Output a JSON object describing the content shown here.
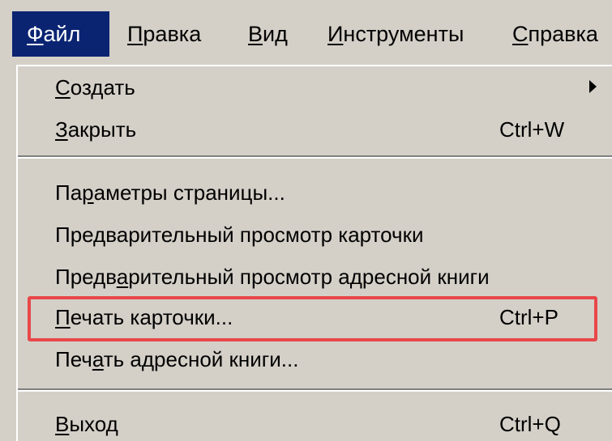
{
  "menubar": {
    "items": [
      {
        "label": "Файл",
        "active": true
      },
      {
        "label": "Правка",
        "active": false
      },
      {
        "label": "Вид",
        "active": false
      },
      {
        "label": "Инструменты",
        "active": false
      },
      {
        "label": "Справка",
        "active": false
      }
    ]
  },
  "file_menu": {
    "items": [
      {
        "label": "Создать",
        "shortcut": "",
        "has_submenu": true
      },
      {
        "label": "Закрыть",
        "shortcut": "Ctrl+W",
        "has_submenu": false
      },
      {
        "label": "Параметры страницы...",
        "shortcut": "",
        "has_submenu": false
      },
      {
        "label": "Предварительный просмотр карточки",
        "shortcut": "",
        "has_submenu": false
      },
      {
        "label": "Предварительный просмотр адресной книги",
        "shortcut": "",
        "has_submenu": false
      },
      {
        "label": "Печать карточки...",
        "shortcut": "Ctrl+P",
        "has_submenu": false,
        "highlighted": true
      },
      {
        "label": "Печать адресной книги...",
        "shortcut": "",
        "has_submenu": false
      },
      {
        "label": "Выход",
        "shortcut": "Ctrl+Q",
        "has_submenu": false
      }
    ]
  },
  "colors": {
    "menu_bg": "#d4d0c8",
    "active_menu_bg": "#0a2472",
    "highlight_border": "#e8474a"
  }
}
